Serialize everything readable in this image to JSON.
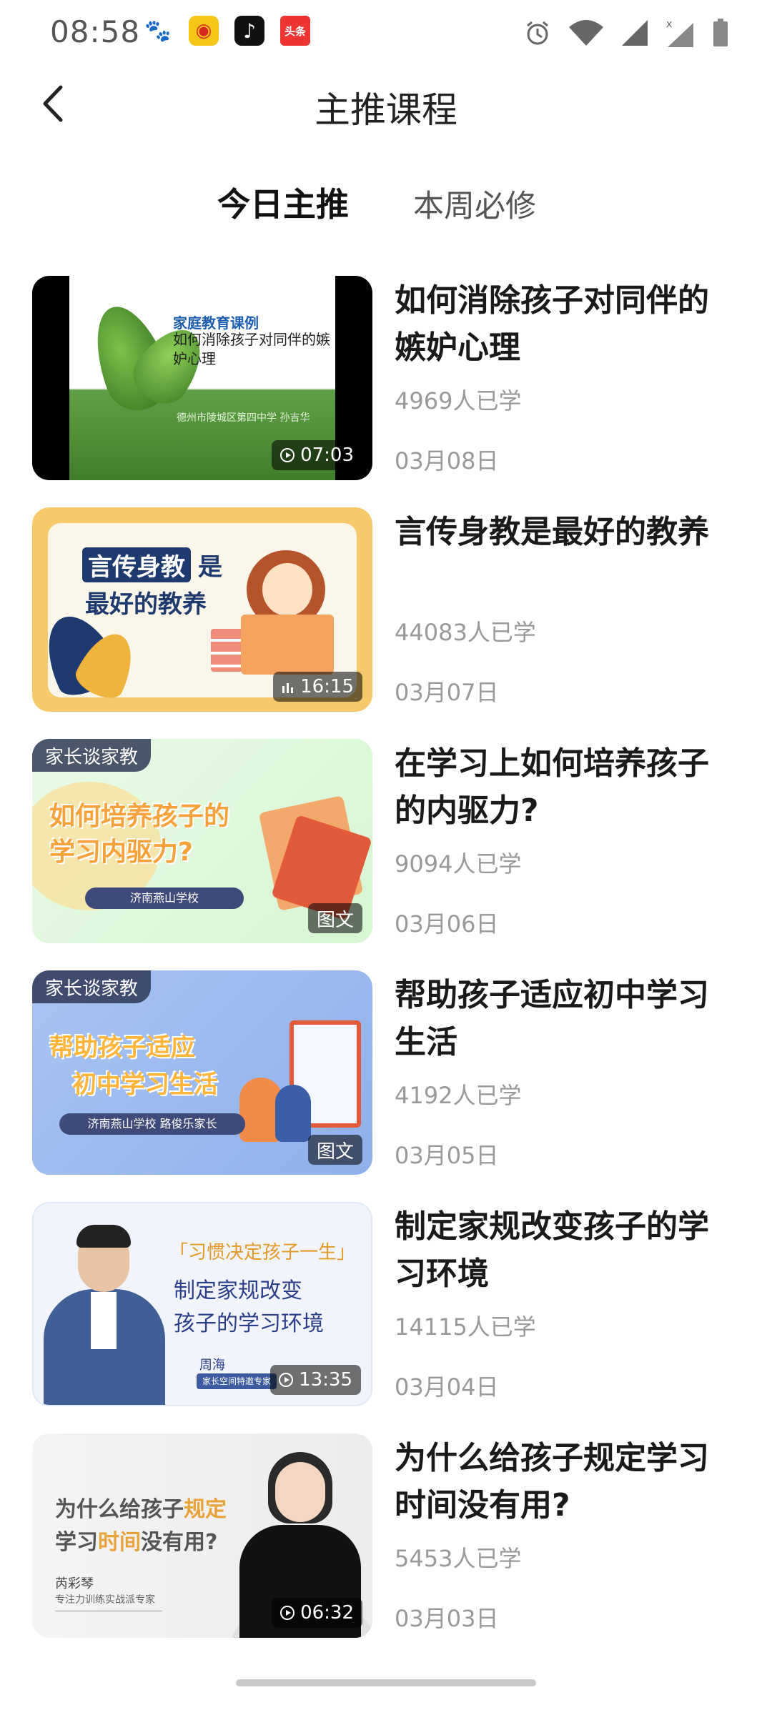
{
  "status_bar": {
    "time": "08:58",
    "app_icons": [
      "baidu-icon",
      "weibo-icon",
      "tiktok-icon",
      "toutiao-icon"
    ],
    "toutiao_label": "头条",
    "right_icons": [
      "alarm-icon",
      "wifi-icon",
      "signal-icon",
      "signal-no-sim-icon",
      "battery-icon"
    ]
  },
  "nav": {
    "title": "主推课程"
  },
  "tabs": [
    {
      "label": "今日主推",
      "active": true
    },
    {
      "label": "本周必修",
      "active": false
    }
  ],
  "courses": [
    {
      "title": "如何消除孩子对同伴的嫉妒心理",
      "learners": "4969人已学",
      "date": "03月08日",
      "badge": "07:03",
      "badge_type": "video",
      "thumb": {
        "heading": "家庭教育课例",
        "subtitle": "如何消除孩子对同伴的嫉妒心理",
        "footer": "德州市陵城区第四中学  孙吉华"
      }
    },
    {
      "title": "言传身教是最好的教养",
      "learners": "44083人已学",
      "date": "03月07日",
      "badge": "16:15",
      "badge_type": "audio",
      "thumb": {
        "line1a": "言传身教",
        "line1b": "是",
        "line2": "最好的教养"
      }
    },
    {
      "title": "在学习上如何培养孩子的内驱力?",
      "learners": "9094人已学",
      "date": "03月06日",
      "badge": "图文",
      "badge_type": "article",
      "tag": "家长谈家教",
      "thumb": {
        "line1": "如何培养孩子的",
        "line2": "学习内驱力?",
        "pill": "济南燕山学校"
      }
    },
    {
      "title": "帮助孩子适应初中学习生活",
      "learners": "4192人已学",
      "date": "03月05日",
      "badge": "图文",
      "badge_type": "article",
      "tag": "家长谈家教",
      "thumb": {
        "line1": "帮助孩子适应",
        "line2": "初中学习生活",
        "pill": "济南燕山学校  路俊乐家长"
      }
    },
    {
      "title": "制定家规改变孩子的学习环境",
      "learners": "14115人已学",
      "date": "03月04日",
      "badge": "13:35",
      "badge_type": "video",
      "thumb": {
        "tag": "「习惯决定孩子一生」",
        "line1": "制定家规改变",
        "line2": "孩子的学习环境",
        "name": "周海",
        "sub": "家长空间特邀专家"
      }
    },
    {
      "title": "为什么给孩子规定学习时间没有用?",
      "learners": "5453人已学",
      "date": "03月03日",
      "badge": "06:32",
      "badge_type": "video",
      "thumb": {
        "line1a": "为什么给孩子",
        "line1b": "规定",
        "line2a": "学习",
        "line2b": "时间",
        "line2c": "没有用?",
        "name": "芮彩琴",
        "sub": "专注力训练实战派专家"
      }
    }
  ],
  "colors": {
    "tab_underline_start": "#ff3b2f",
    "tab_underline_end": "#ff7a3c",
    "meta_text": "#999999"
  }
}
